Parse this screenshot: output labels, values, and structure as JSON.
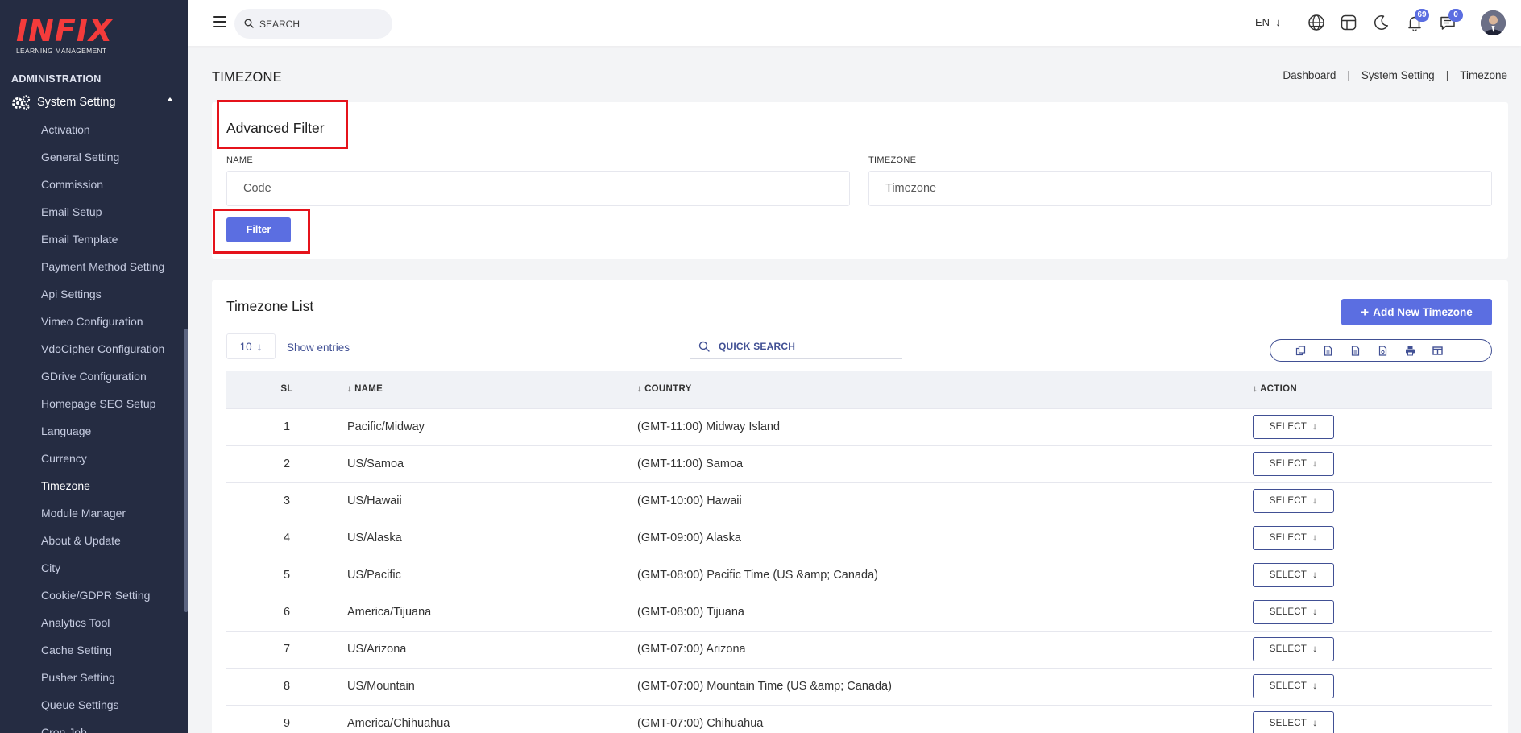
{
  "brand": {
    "name": "INFIX",
    "subtitle": "LEARNING MANAGEMENT"
  },
  "sidebar": {
    "section": "ADMINISTRATION",
    "group": "System Setting",
    "items": [
      "Activation",
      "General Setting",
      "Commission",
      "Email Setup",
      "Email Template",
      "Payment Method Setting",
      "Api Settings",
      "Vimeo Configuration",
      "VdoCipher Configuration",
      "GDrive Configuration",
      "Homepage SEO Setup",
      "Language",
      "Currency",
      "Timezone",
      "Module Manager",
      "About & Update",
      "City",
      "Cookie/GDPR Setting",
      "Analytics Tool",
      "Cache Setting",
      "Pusher Setting",
      "Queue Settings",
      "Cron Job"
    ],
    "active": "Timezone"
  },
  "topbar": {
    "search_placeholder": "SEARCH",
    "language": "EN",
    "notifications_count": "69",
    "messages_count": "0"
  },
  "page": {
    "title": "TIMEZONE",
    "breadcrumb": [
      "Dashboard",
      "System Setting",
      "Timezone"
    ]
  },
  "filter": {
    "title": "Advanced Filter",
    "name_label": "NAME",
    "name_placeholder": "Code",
    "timezone_label": "TIMEZONE",
    "timezone_placeholder": "Timezone",
    "button": "Filter"
  },
  "list": {
    "title": "Timezone List",
    "add_button": "Add New Timezone",
    "page_size": "10",
    "show_entries": "Show entries",
    "quick_search": "QUICK SEARCH",
    "export_icons": [
      "copy-icon",
      "csv-icon",
      "excel-icon",
      "pdf-icon",
      "print-icon",
      "columns-icon"
    ],
    "columns": {
      "sl": "SL",
      "name": "NAME",
      "country": "COUNTRY",
      "action": "ACTION"
    },
    "select_label": "SELECT",
    "rows": [
      {
        "sl": "1",
        "name": "Pacific/Midway",
        "country": "(GMT-11:00) Midway Island"
      },
      {
        "sl": "2",
        "name": "US/Samoa",
        "country": "(GMT-11:00) Samoa"
      },
      {
        "sl": "3",
        "name": "US/Hawaii",
        "country": "(GMT-10:00) Hawaii"
      },
      {
        "sl": "4",
        "name": "US/Alaska",
        "country": "(GMT-09:00) Alaska"
      },
      {
        "sl": "5",
        "name": "US/Pacific",
        "country": "(GMT-08:00) Pacific Time (US &amp; Canada)"
      },
      {
        "sl": "6",
        "name": "America/Tijuana",
        "country": "(GMT-08:00) Tijuana"
      },
      {
        "sl": "7",
        "name": "US/Arizona",
        "country": "(GMT-07:00) Arizona"
      },
      {
        "sl": "8",
        "name": "US/Mountain",
        "country": "(GMT-07:00) Mountain Time (US &amp; Canada)"
      },
      {
        "sl": "9",
        "name": "America/Chihuahua",
        "country": "(GMT-07:00) Chihuahua"
      }
    ]
  },
  "colors": {
    "primary": "#5b6ee1",
    "sidebar": "#252c42",
    "highlight": "#e5131b"
  }
}
